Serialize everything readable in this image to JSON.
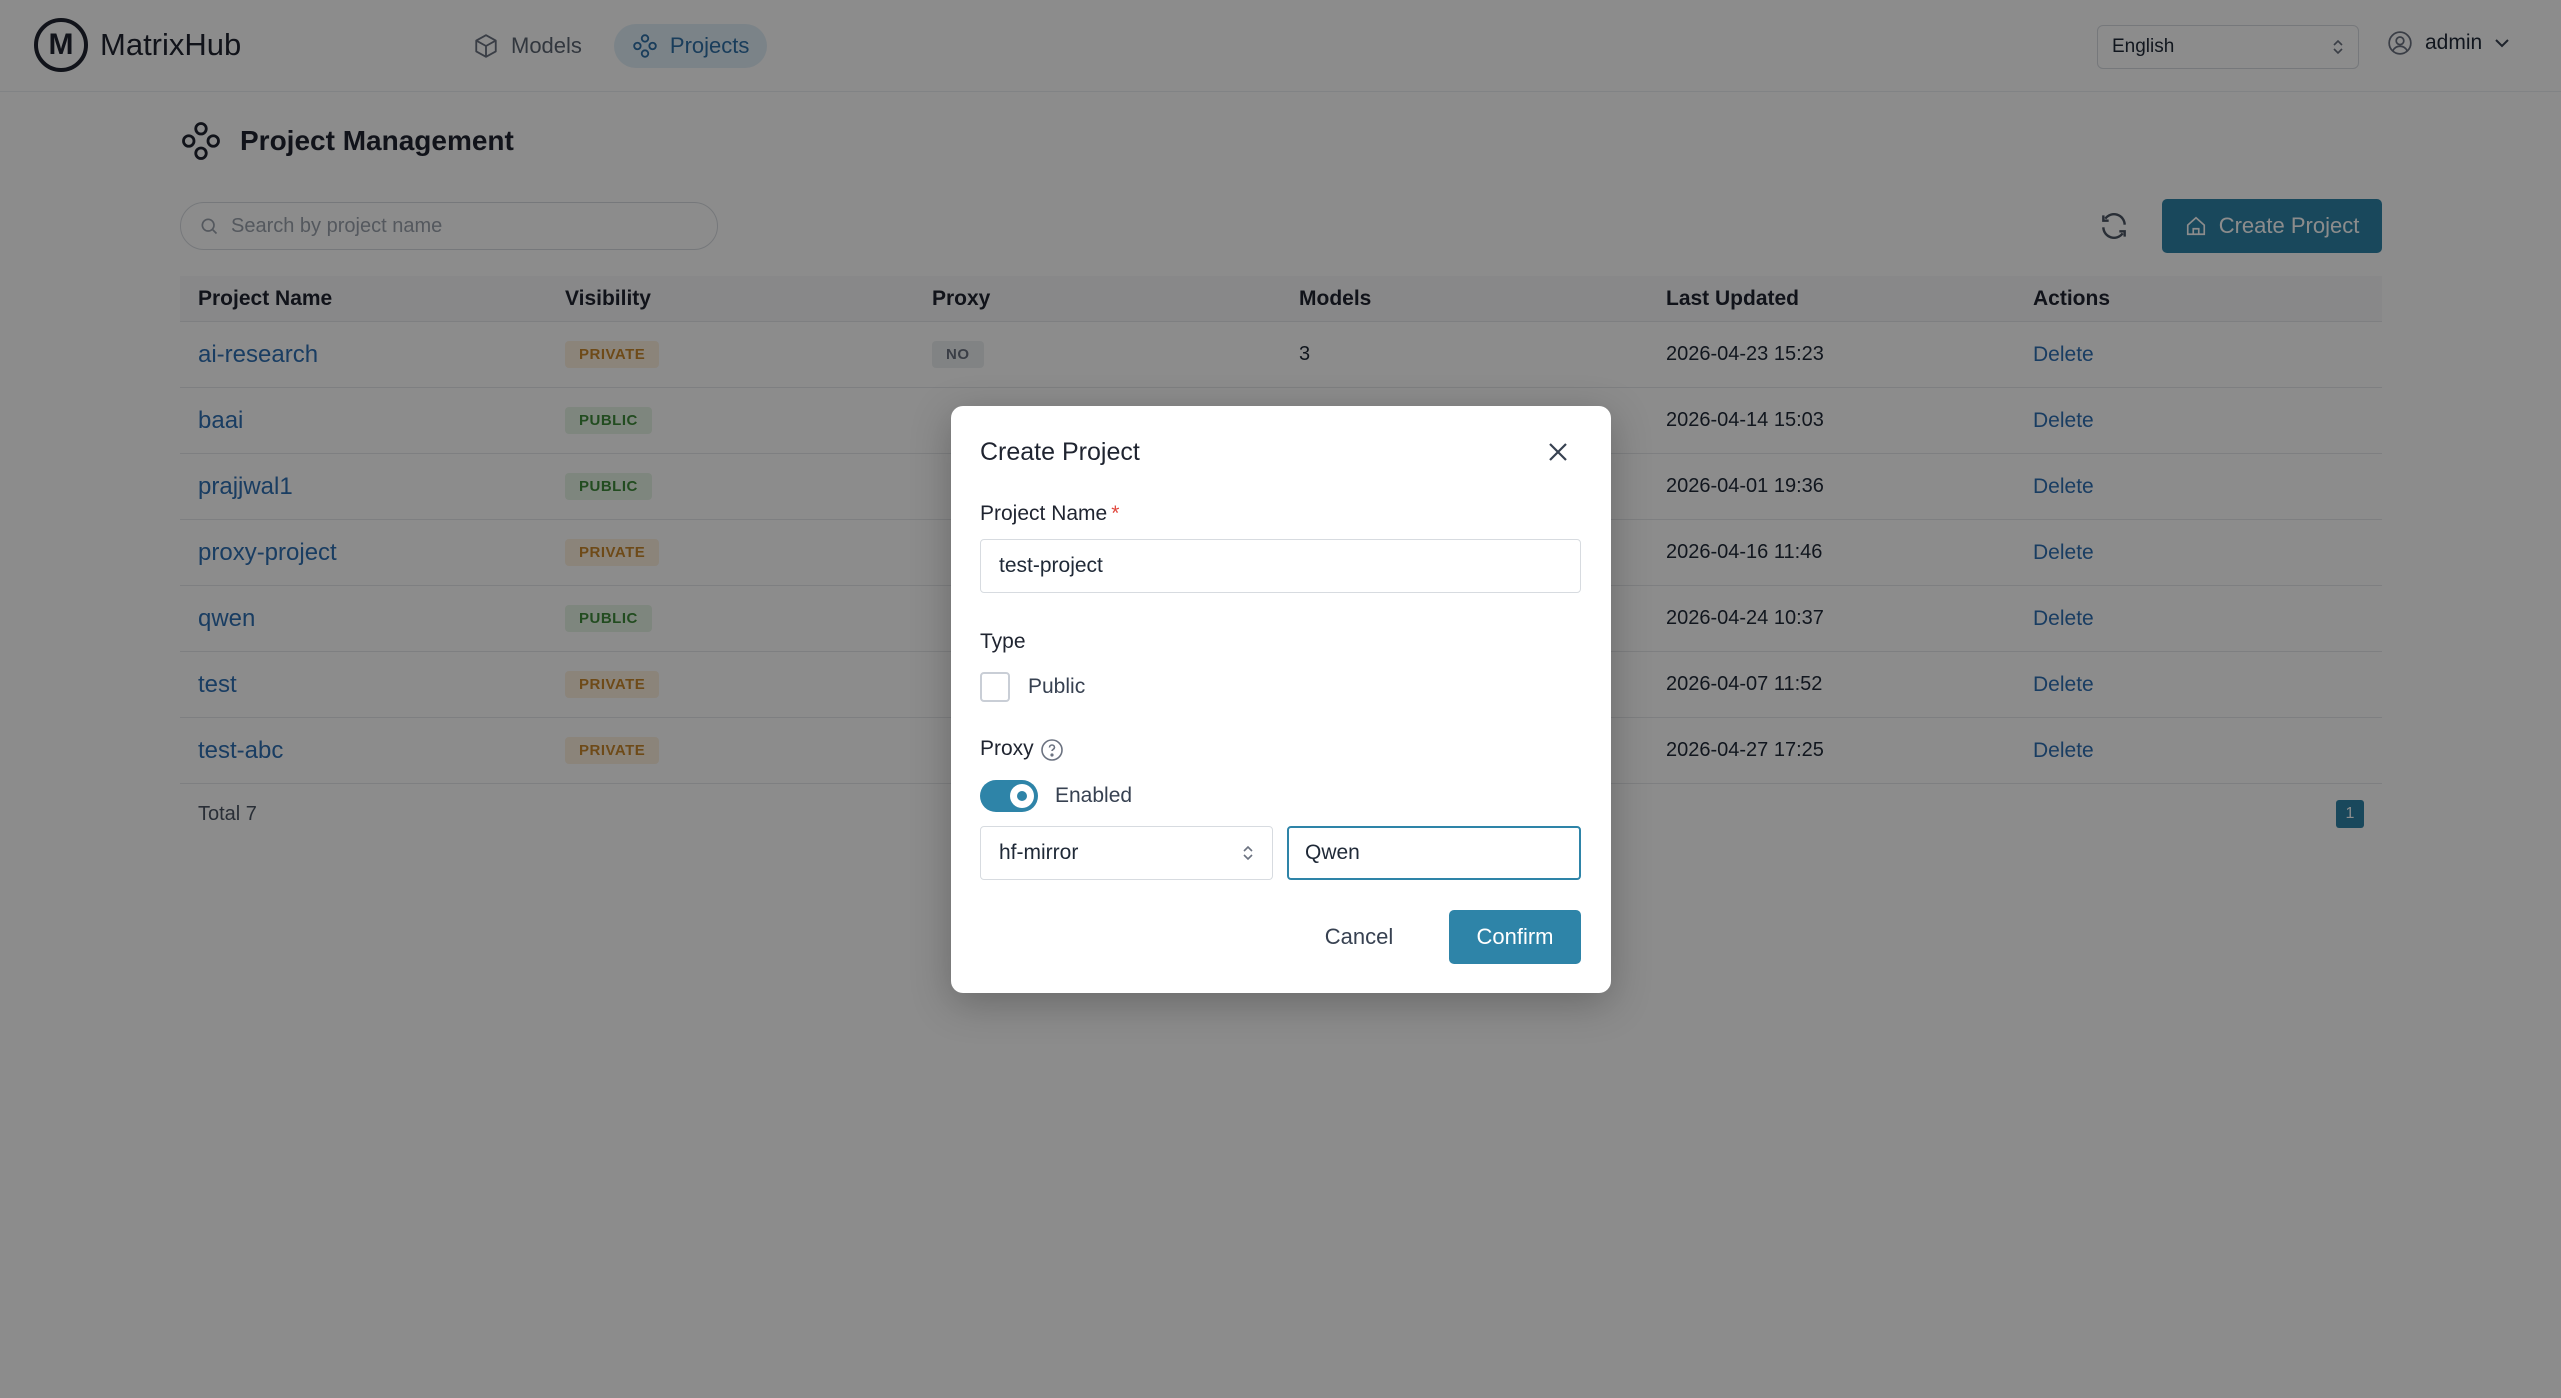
{
  "app": {
    "name": "MatrixHub",
    "logo_letter": "M"
  },
  "nav": {
    "items": [
      {
        "label": "Models",
        "icon": "cube-icon"
      },
      {
        "label": "Projects",
        "icon": "projects-icon"
      }
    ],
    "active": "Projects"
  },
  "header": {
    "language": "English",
    "user": "admin"
  },
  "page": {
    "title": "Project Management",
    "search_placeholder": "Search by project name",
    "create_label": "Create Project"
  },
  "table": {
    "columns": [
      "Project Name",
      "Visibility",
      "Proxy",
      "Models",
      "Last Updated",
      "Actions"
    ],
    "rows": [
      {
        "name": "ai-research",
        "visibility": "PRIVATE",
        "proxy": "NO",
        "models": "3",
        "updated": "2026-04-23 15:23",
        "action": "Delete"
      },
      {
        "name": "baai",
        "visibility": "PUBLIC",
        "proxy": "",
        "models": "",
        "updated": "2026-04-14 15:03",
        "action": "Delete"
      },
      {
        "name": "prajjwal1",
        "visibility": "PUBLIC",
        "proxy": "",
        "models": "",
        "updated": "2026-04-01 19:36",
        "action": "Delete"
      },
      {
        "name": "proxy-project",
        "visibility": "PRIVATE",
        "proxy": "",
        "models": "",
        "updated": "2026-04-16 11:46",
        "action": "Delete"
      },
      {
        "name": "qwen",
        "visibility": "PUBLIC",
        "proxy": "",
        "models": "",
        "updated": "2026-04-24 10:37",
        "action": "Delete"
      },
      {
        "name": "test",
        "visibility": "PRIVATE",
        "proxy": "",
        "models": "",
        "updated": "2026-04-07 11:52",
        "action": "Delete"
      },
      {
        "name": "test-abc",
        "visibility": "PRIVATE",
        "proxy": "",
        "models": "",
        "updated": "2026-04-27 17:25",
        "action": "Delete"
      }
    ],
    "total": "Total 7",
    "page": "1"
  },
  "modal": {
    "title": "Create Project",
    "name_label": "Project Name",
    "required_mark": "*",
    "name_value": "test-project",
    "type_label": "Type",
    "public_label": "Public",
    "public_checked": false,
    "proxy_label": "Proxy",
    "proxy_enabled_label": "Enabled",
    "proxy_enabled": true,
    "proxy_source": "hf-mirror",
    "proxy_repo_value": "Qwen",
    "cancel_label": "Cancel",
    "confirm_label": "Confirm"
  },
  "colors": {
    "accent": "#2e84a8",
    "link": "#2f6fb3",
    "private_badge_bg": "#fdf1df",
    "private_badge_text": "#c9882d",
    "public_badge_bg": "#e6f4e5",
    "public_badge_text": "#3f8a3b"
  }
}
